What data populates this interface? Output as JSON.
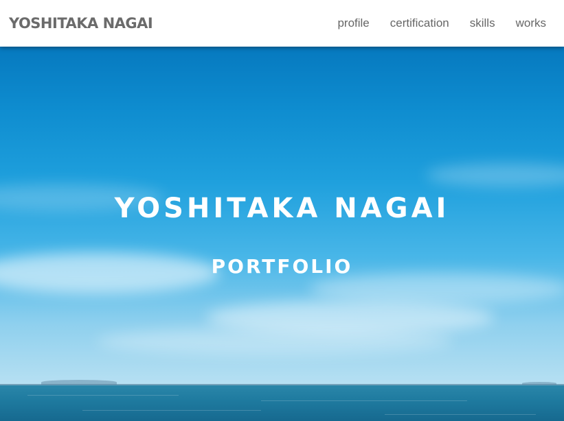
{
  "header": {
    "logo_text": "YOSHITAKA NAGAI",
    "nav": [
      {
        "label": "profile"
      },
      {
        "label": "certification"
      },
      {
        "label": "skills"
      },
      {
        "label": "works"
      }
    ]
  },
  "hero": {
    "title": "YOSHITAKA NAGAI",
    "subtitle": "PORTFOLIO",
    "background": "sky-and-sea-photo"
  },
  "colors": {
    "header_bg": "#ffffff",
    "logo_text": "#6b6b6b",
    "nav_text": "#666666",
    "sky_top": "#0679bf",
    "sky_bottom": "#b7e0f2",
    "sea": "#1f7ba0",
    "hero_text": "#ffffff"
  }
}
